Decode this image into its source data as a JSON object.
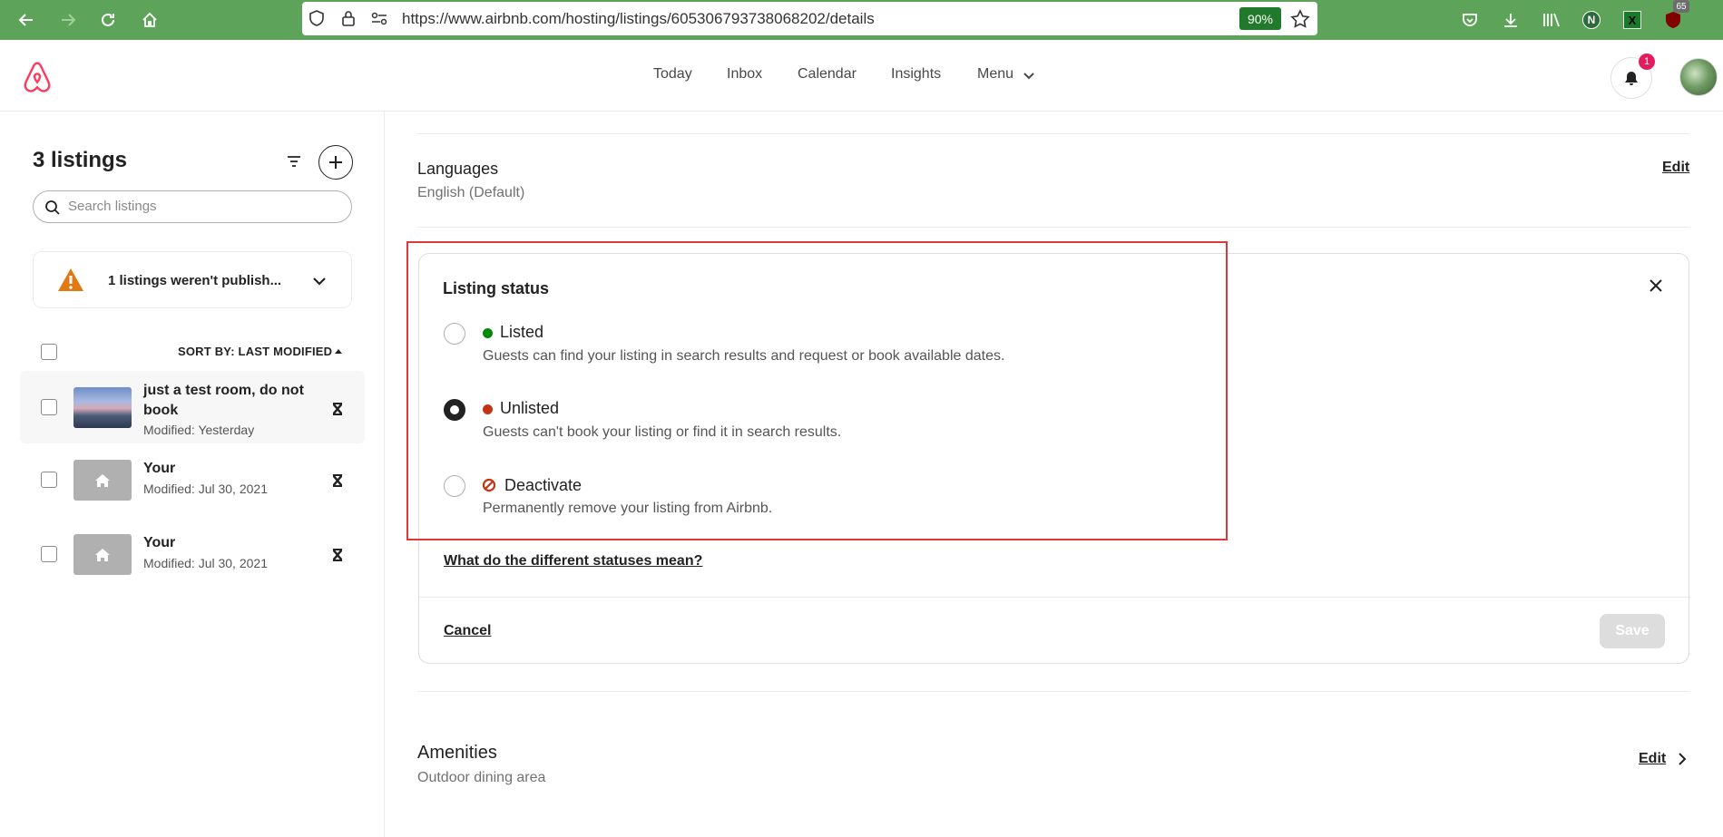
{
  "browser": {
    "url": "https://www.airbnb.com/hosting/listings/605306793738068202/details",
    "zoom": "90%",
    "ext_badge_count": "65",
    "ext_n_label": "N",
    "ext_x_label": "X"
  },
  "header": {
    "nav": [
      "Today",
      "Inbox",
      "Calendar",
      "Insights",
      "Menu"
    ],
    "notification_count": "1",
    "brand_color": "#ff385c"
  },
  "sidebar": {
    "title": "3 listings",
    "search_placeholder": "Search listings",
    "warning_text": "1 listings weren't publish...",
    "sort_label": "SORT BY: LAST MODIFIED",
    "listings": [
      {
        "title_line1": "just a test room, do not",
        "title_line2": "book",
        "modified": "Modified: Yesterday",
        "thumb": "photo"
      },
      {
        "title_line1": "Your",
        "title_line2": "",
        "modified": "Modified: Jul 30, 2021",
        "thumb": "home-icon"
      },
      {
        "title_line1": "Your",
        "title_line2": "",
        "modified": "Modified: Jul 30, 2021",
        "thumb": "home-icon"
      }
    ]
  },
  "main": {
    "languages": {
      "title": "Languages",
      "value": "English (Default)",
      "edit_label": "Edit"
    },
    "listing_status": {
      "title": "Listing status",
      "options": [
        {
          "label": "Listed",
          "description": "Guests can find your listing in search results and request or book available dates.",
          "selected": false,
          "color": "#008a05"
        },
        {
          "label": "Unlisted",
          "description": "Guests can't book your listing or find it in search results.",
          "selected": true,
          "color": "#c13515"
        },
        {
          "label": "Deactivate",
          "description": "Permanently remove your listing from Airbnb.",
          "selected": false,
          "color": "#c13515"
        }
      ],
      "help_link": "What do the different statuses mean?",
      "cancel_label": "Cancel",
      "save_label": "Save"
    },
    "amenities": {
      "title": "Amenities",
      "value": "Outdoor dining area",
      "edit_label": "Edit"
    }
  }
}
